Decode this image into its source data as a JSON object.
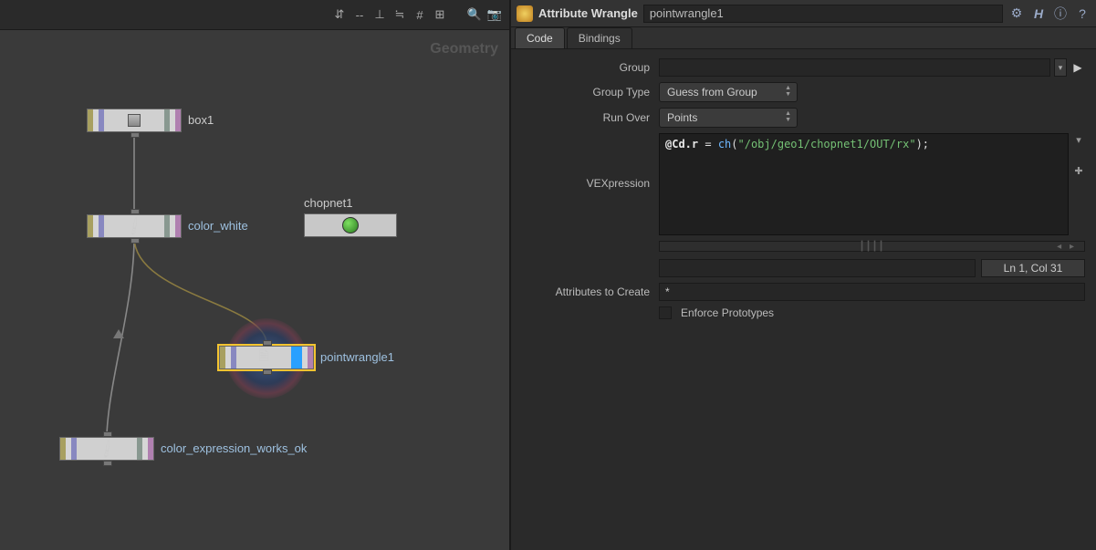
{
  "graph": {
    "section_label": "Geometry",
    "nodes": {
      "box": {
        "label": "box1"
      },
      "color_white": {
        "label": "color_white"
      },
      "pointwrangle": {
        "label": "pointwrangle1"
      },
      "color_expr": {
        "label": "color_expression_works_ok"
      },
      "chopnet": {
        "label": "chopnet1"
      }
    }
  },
  "params": {
    "header": {
      "type_label": "Attribute Wrangle",
      "node_path": "pointwrangle1"
    },
    "tabs": {
      "code": "Code",
      "bindings": "Bindings"
    },
    "labels": {
      "group": "Group",
      "group_type": "Group Type",
      "run_over": "Run Over",
      "vexpression": "VEXpression",
      "attrs_to_create": "Attributes to Create",
      "enforce_prototypes": "Enforce Prototypes"
    },
    "values": {
      "group": "",
      "group_type": "Guess from Group",
      "run_over": "Points",
      "attrs_to_create": "*",
      "cursor_pos": "Ln 1, Col 31"
    },
    "vex": {
      "var": "@Cd.r",
      "eq": " = ",
      "fn": "ch",
      "open": "(",
      "str": "\"/obj/geo1/chopnet1/OUT/rx\"",
      "close": ");"
    }
  },
  "chart_data": null
}
